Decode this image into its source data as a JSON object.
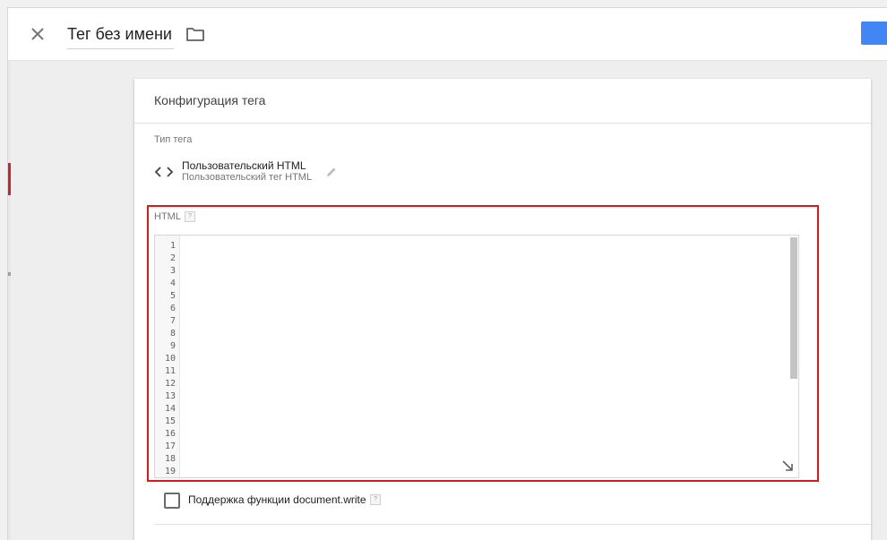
{
  "header": {
    "title": "Тег без имени"
  },
  "card": {
    "title": "Конфигурация тега",
    "tag_type_label": "Тип тега",
    "tag_type_name": "Пользовательский HTML",
    "tag_type_description": "Пользовательский тег HTML",
    "html_label": "HTML",
    "help_mark": "?",
    "line_numbers": [
      "1",
      "2",
      "3",
      "4",
      "5",
      "6",
      "7",
      "8",
      "9",
      "10",
      "11",
      "12",
      "13",
      "14",
      "15",
      "16",
      "17",
      "18",
      "19"
    ],
    "document_write_label": "Поддержка функции document.write"
  },
  "colors": {
    "accent": "#4285f4",
    "highlight": "#e0161b"
  },
  "icons": {
    "close": "close-icon",
    "folder": "folder-icon",
    "code": "code-icon",
    "edit": "pencil-icon",
    "resize": "resize-icon",
    "expand": "chevron-right-icon"
  }
}
